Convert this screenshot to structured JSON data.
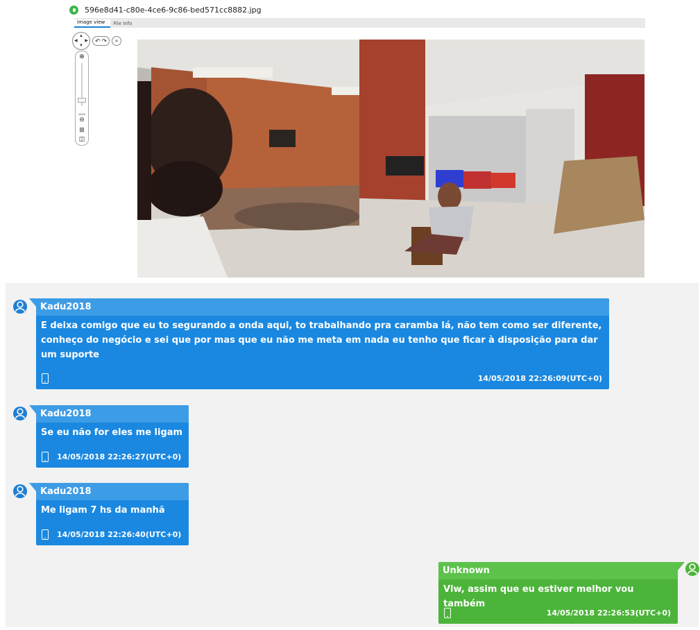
{
  "viewer": {
    "file_name": "596e8d41-c80e-4ce6-9c86-bed571cc8882.jpg",
    "tabs": [
      {
        "label": "Image view",
        "active": true
      },
      {
        "label": "File Info",
        "active": false
      }
    ],
    "zoom_level": "100%",
    "icons": {
      "file": "image-file-icon",
      "pan": "pan-arrows-icon",
      "rotate_left": "rotate-left-icon",
      "rotate_right": "rotate-right-icon",
      "collapse": "double-chevron-left-icon",
      "zoom_in": "zoom-in-icon",
      "zoom_out": "zoom-out-icon",
      "fit": "fit-to-window-icon",
      "actual_size": "actual-size-icon"
    }
  },
  "messages": [
    {
      "direction": "incoming",
      "sender": "Kadu2018",
      "text": "E deixa comigo que eu to segurando a onda aqui, to trabalhando pra caramba lá, não tem como ser diferente, conheço do negócio e sei que por mas que eu não me meta em nada eu tenho que ficar à disposição para dar um suporte",
      "timestamp": "14/05/2018 22:26:09(UTC+0)",
      "source_icon": "mobile-phone-icon"
    },
    {
      "direction": "incoming",
      "sender": "Kadu2018",
      "text": "Se eu não for eles me ligam",
      "timestamp": "14/05/2018 22:26:27(UTC+0)",
      "source_icon": "mobile-phone-icon"
    },
    {
      "direction": "incoming",
      "sender": "Kadu2018",
      "text": "Me ligam 7 hs da manhã",
      "timestamp": "14/05/2018 22:26:40(UTC+0)",
      "source_icon": "mobile-phone-icon"
    },
    {
      "direction": "outgoing",
      "sender": "Unknown",
      "text": "Vlw, assim que eu estiver melhor vou também",
      "timestamp": "14/05/2018 22:26:53(UTC+0)",
      "source_icon": "mobile-phone-icon"
    }
  ],
  "colors": {
    "incoming_body": "#1a88e0",
    "incoming_header": "#3d9ce6",
    "outgoing_body": "#4cb43a",
    "outgoing_header": "#5cc24b",
    "chat_background": "#f2f2f2"
  }
}
